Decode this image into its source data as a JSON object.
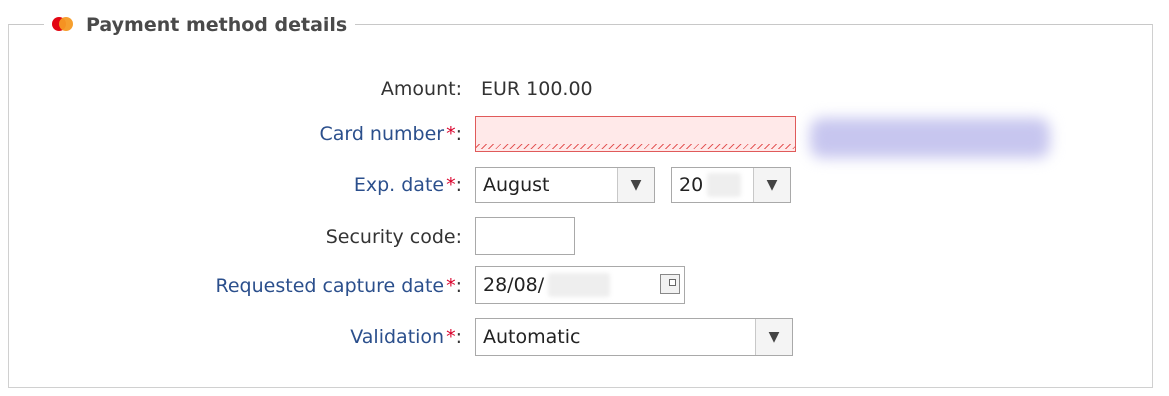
{
  "section": {
    "title": "Payment method details",
    "icon": "mastercard-icon"
  },
  "amount": {
    "label": "Amount:",
    "value": "EUR 100.00"
  },
  "card_number": {
    "label": "Card number",
    "required": "*",
    "colon": ":",
    "value": ""
  },
  "exp_date": {
    "label": "Exp. date",
    "required": "*",
    "colon": ":",
    "month": "August",
    "year_prefix": "20"
  },
  "security_code": {
    "label": "Security code:",
    "value": ""
  },
  "capture_date": {
    "label": "Requested capture date",
    "required": "*",
    "colon": ":",
    "value_prefix": "28/08/"
  },
  "validation": {
    "label": "Validation",
    "required": "*",
    "colon": ":",
    "value": "Automatic"
  },
  "colors": {
    "link_label": "#2b4f8c",
    "required_star": "#d9002a",
    "error_background": "#ffe9e9",
    "error_border": "#e05a5a"
  }
}
